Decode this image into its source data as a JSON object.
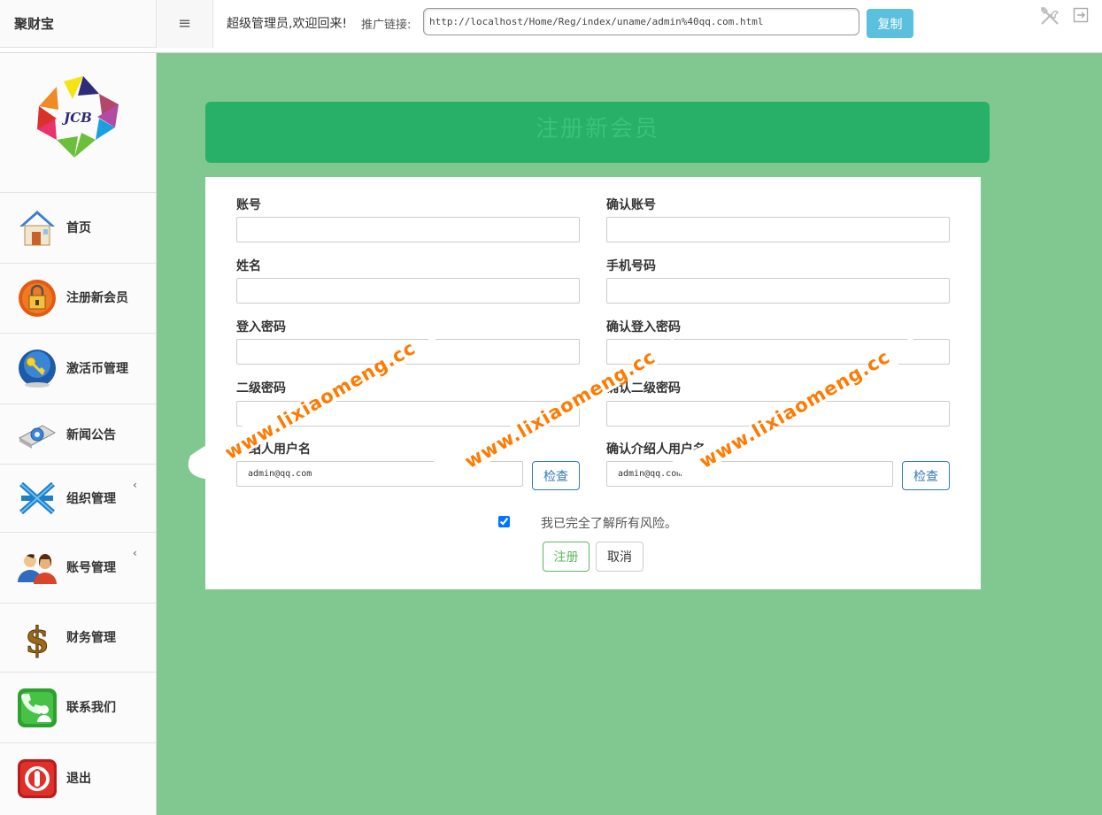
{
  "header": {
    "brand": "聚财宝",
    "menu_toggle": "≡",
    "welcome": "超级管理员,欢迎回来!",
    "promo_label": "推广链接:",
    "promo_url": "http://localhost/Home/Reg/index/uname/admin%40qq.com.html",
    "copy_label": "复制"
  },
  "sidebar": {
    "logo_text": "JCB",
    "items": [
      {
        "label": "首页",
        "icon": "house-icon"
      },
      {
        "label": "注册新会员",
        "icon": "lock-icon"
      },
      {
        "label": "激活币管理",
        "icon": "key-icon"
      },
      {
        "label": "新闻公告",
        "icon": "news-icon"
      },
      {
        "label": "组织管理",
        "icon": "network-icon",
        "arrow": "‹"
      },
      {
        "label": "账号管理",
        "icon": "users-icon",
        "arrow": "‹"
      },
      {
        "label": "财务管理",
        "icon": "dollar-icon"
      },
      {
        "label": "联系我们",
        "icon": "contact-icon"
      },
      {
        "label": "退出",
        "icon": "power-icon"
      }
    ]
  },
  "main": {
    "title": "注册新会员",
    "fields": {
      "account": "账号",
      "confirm_account": "确认账号",
      "name": "姓名",
      "phone": "手机号码",
      "login_password": "登入密码",
      "confirm_login_password": "确认登入密码",
      "second_password": "二级密码",
      "confirm_second_password": "确认二级密码",
      "referrer": "介绍人用户名",
      "confirm_referrer": "确认介绍人用户名"
    },
    "referrer_value": "admin@qq.com",
    "confirm_referrer_value": "admin@qq.com",
    "check_label": "检查",
    "agree_text": "我已完全了解所有风险。",
    "submit_label": "注册",
    "cancel_label": "取消"
  },
  "watermark": "www.lixiaomeng.cc",
  "colors": {
    "page_bg": "#80c88f",
    "banner_bg": "#28af68",
    "copy_btn": "#5bc0de",
    "primary_outline": "#337ab7",
    "success_outline": "#5cb85c",
    "watermark": "#ff7a00"
  }
}
